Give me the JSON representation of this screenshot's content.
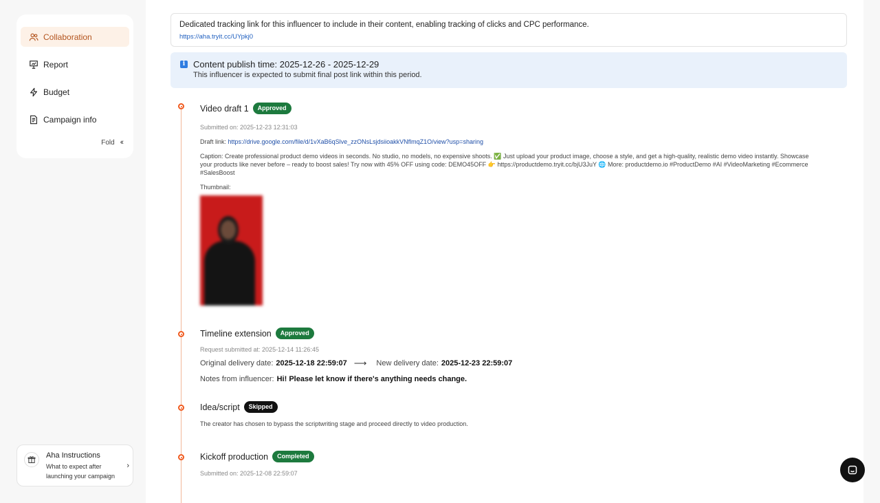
{
  "sidebar": {
    "items": [
      {
        "label": "Collaboration",
        "icon": "users-icon",
        "active": true
      },
      {
        "label": "Report",
        "icon": "presentation-icon",
        "active": false
      },
      {
        "label": "Budget",
        "icon": "lightning-icon",
        "active": false
      },
      {
        "label": "Campaign info",
        "icon": "document-icon",
        "active": false
      }
    ],
    "fold_label": "Fold",
    "aha": {
      "title": "Aha Instructions",
      "subtitle": "What to expect after launching your campaign"
    }
  },
  "tracking": {
    "description": "Dedicated tracking link for this influencer to include in their content, enabling tracking of clicks and CPC performance.",
    "link": "https://aha.tryit.cc/UYpkj0"
  },
  "publish": {
    "title": "Content publish time: 2025-12-26 - 2025-12-29",
    "subtitle": "This influencer is expected to submit final post link within this period."
  },
  "timeline": {
    "video_draft": {
      "title": "Video draft 1",
      "badge": "Approved",
      "submitted": "Submitted on: 2025-12-23 12:31:03",
      "draft_label": "Draft link:",
      "draft_link": "https://drive.google.com/file/d/1vXaB6qSlve_zzONsLsjdsiioakkVNflmqZ1O/view?usp=sharing",
      "caption": "Caption: Create professional product demo videos in seconds. No studio, no models, no expensive shoots. ✅ Just upload your product image, choose a style, and get a high-quality, realistic demo video instantly. Showcase your products like never before – ready to boost sales! Try now with 45% OFF using code: DEMO45OFF 👉 https://productdemo.tryit.cc/bjU3JuY 🌐 More: productdemo.io #ProductDemo #AI #VideoMarketing #Ecommerce #SalesBoost",
      "thumbnail_label": "Thumbnail:"
    },
    "timeline_extension": {
      "title": "Timeline extension",
      "badge": "Approved",
      "requested": "Request submitted at: 2025-12-14 11:26:45",
      "original_label": "Original delivery date:",
      "original_value": "2025-12-18 22:59:07",
      "new_label": "New delivery date:",
      "new_value": "2025-12-23 22:59:07",
      "notes_label": "Notes from influencer:",
      "notes_value": "Hi! Please let know if there's anything needs change."
    },
    "idea_script": {
      "title": "Idea/script",
      "badge": "Skipped",
      "description": "The creator has chosen to bypass the scriptwriting stage and proceed directly to video production."
    },
    "kickoff": {
      "title": "Kickoff production",
      "badge": "Completed",
      "submitted": "Submitted on: 2025-12-08 22:59:07"
    }
  },
  "colors": {
    "accent": "#f05a1e",
    "approved": "#1d7a3e",
    "link": "#1f5fbf",
    "active_nav_bg": "#fdf1e7"
  },
  "chat": {
    "icon": "chat-icon"
  }
}
